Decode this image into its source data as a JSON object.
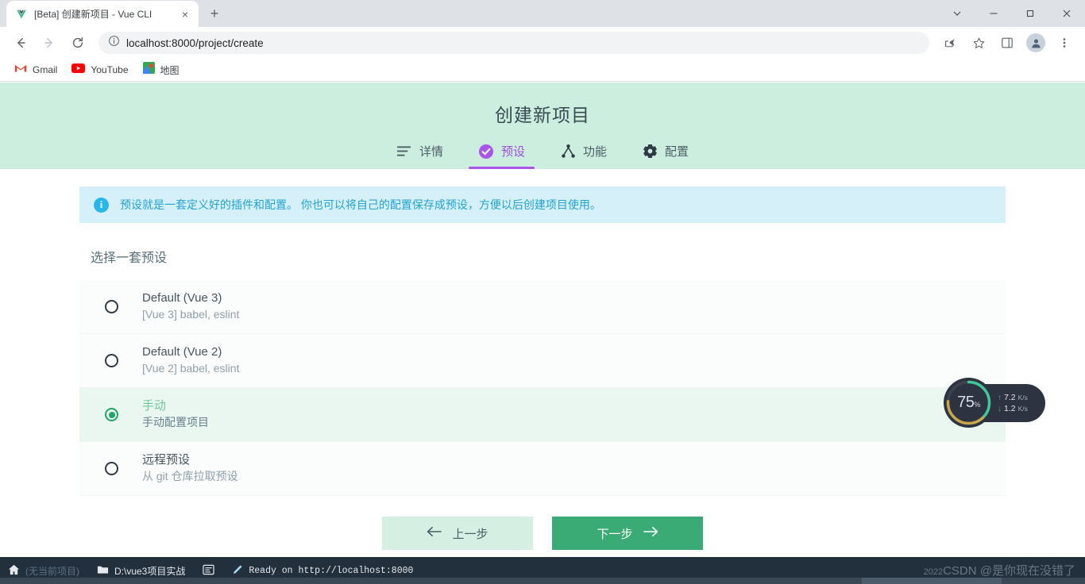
{
  "browser": {
    "tab": {
      "title": "[Beta] 创建新项目 - Vue CLI",
      "favicon": "vue-logo-icon",
      "close": "×"
    },
    "newtab_label": "+",
    "window_controls": {
      "chevron": "⌄",
      "minimize": "—",
      "maximize": "❐",
      "close": "✕"
    },
    "nav": {
      "back": "←",
      "forward": "→",
      "reload": "⟳"
    },
    "omnibox": {
      "url": "localhost:8000/project/create",
      "security_icon": "info-circle-icon"
    },
    "toolbar_icons": [
      "share-icon",
      "star-icon",
      "sidepanel-icon",
      "profile-avatar-icon",
      "kebab-menu-icon"
    ],
    "bookmarks": [
      {
        "label": "Gmail",
        "icon": "gmail-icon"
      },
      {
        "label": "YouTube",
        "icon": "youtube-icon"
      },
      {
        "label": "地图",
        "icon": "maps-icon"
      }
    ]
  },
  "vuecli": {
    "page_title": "创建新项目",
    "tabs": [
      {
        "label": "详情",
        "icon": "list-icon",
        "active": false
      },
      {
        "label": "预设",
        "icon": "check-circle-icon",
        "active": true
      },
      {
        "label": "功能",
        "icon": "sitemap-icon",
        "active": false
      },
      {
        "label": "配置",
        "icon": "gear-icon",
        "active": false
      }
    ],
    "info_banner": {
      "icon": "info-icon",
      "text": "预设就是一套定义好的插件和配置。 你也可以将自己的配置保存成预设，方便以后创建项目使用。"
    },
    "section_title": "选择一套预设",
    "presets": [
      {
        "name": "Default (Vue 3)",
        "desc": "[Vue 3] babel, eslint",
        "selected": false
      },
      {
        "name": "Default (Vue 2)",
        "desc": "[Vue 2] babel, eslint",
        "selected": false
      },
      {
        "name": "手动",
        "desc": "手动配置项目",
        "selected": true
      },
      {
        "name": "远程预设",
        "desc": "从 git 仓库拉取预设",
        "selected": false
      }
    ],
    "buttons": {
      "prev": {
        "label": "上一步",
        "icon": "arrow-left-icon"
      },
      "next": {
        "label": "下一步",
        "icon": "arrow-right-icon"
      }
    },
    "colors": {
      "header_bg": "#cceedf",
      "accent_purple": "#a855e8",
      "accent_green": "#3aab74",
      "info_bg": "#d6f0fa",
      "info_fg": "#21a3d4",
      "selected_row_bg": "#e9f7f0"
    }
  },
  "netwidget": {
    "percent": "75",
    "percent_unit": "%",
    "upload": {
      "arrow": "↑",
      "value": "7.2",
      "unit": "K/s"
    },
    "download": {
      "arrow": "↓",
      "value": "1.2",
      "unit": "K/s"
    }
  },
  "taskbar": {
    "home_icon": "home-icon",
    "no_project_label": "(无当前项目)",
    "folder_icon": "folder-icon",
    "folder_label": "D:\\vue3项目实战",
    "terminal_icon": "terminal-icon",
    "pencil_icon": "pencil-icon",
    "status_text": "Ready on http://localhost:8000"
  },
  "watermark": {
    "year": "2022",
    "text": "CSDN @是你现在没错了"
  }
}
